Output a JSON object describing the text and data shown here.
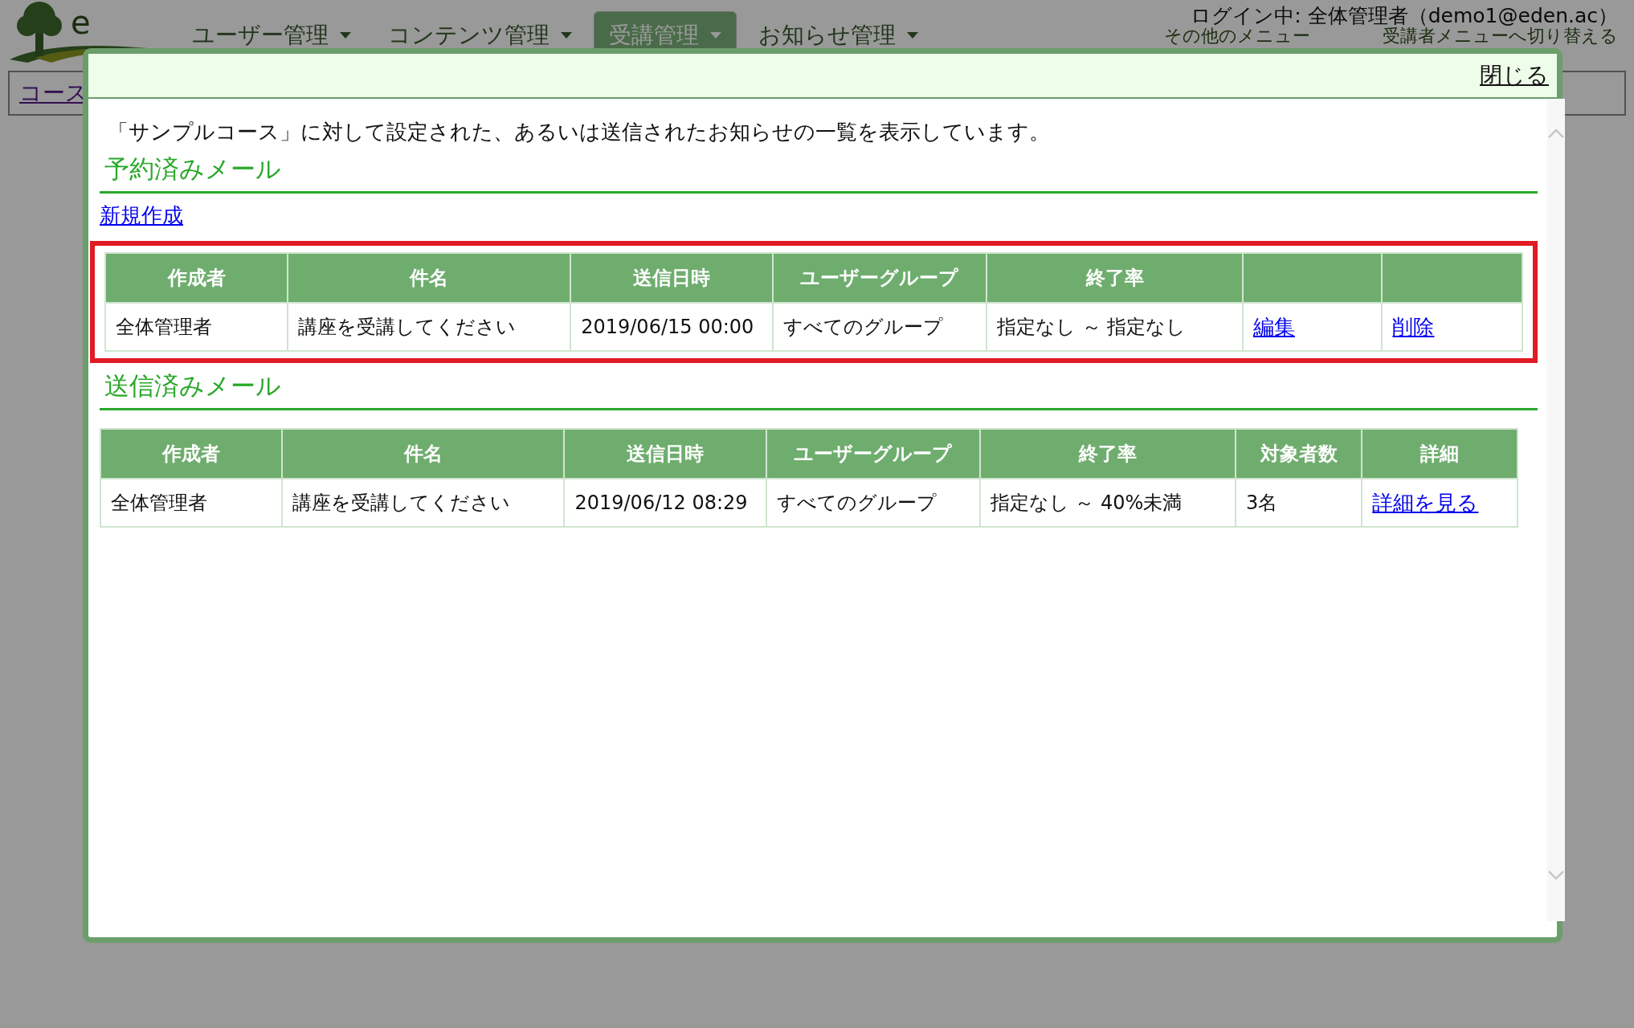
{
  "header": {
    "logo_text": "e",
    "nav": [
      {
        "label": "ユーザー管理",
        "selected": false
      },
      {
        "label": "コンテンツ管理",
        "selected": false
      },
      {
        "label": "受講管理",
        "selected": true
      },
      {
        "label": "お知らせ管理",
        "selected": false
      }
    ],
    "user_info": "ログイン中: 全体管理者（demo1@eden.ac）",
    "sub_links": [
      "その他のメニュー",
      "受講者メニューへ切り替える"
    ]
  },
  "breadcrumb": "コース",
  "dialog": {
    "close": "閉じる",
    "intro": "「サンプルコース」に対して設定された、あるいは送信されたお知らせの一覧を表示しています。",
    "sections": [
      {
        "title": "予約済みメール",
        "new_link": "新規作成",
        "highlighted": true,
        "columns": [
          "作成者",
          "件名",
          "送信日時",
          "ユーザーグループ",
          "終了率",
          "",
          ""
        ],
        "rows": [
          {
            "cells": [
              {
                "kind": "text",
                "text": "全体管理者"
              },
              {
                "kind": "text",
                "text": "講座を受講してください"
              },
              {
                "kind": "text",
                "text": "2019/06/15 00:00"
              },
              {
                "kind": "text",
                "text": "すべてのグループ"
              },
              {
                "kind": "text",
                "text": "指定なし ～ 指定なし"
              },
              {
                "kind": "link",
                "text": "編集"
              },
              {
                "kind": "link",
                "text": "削除"
              }
            ]
          }
        ]
      },
      {
        "title": "送信済みメール",
        "highlighted": false,
        "columns": [
          "作成者",
          "件名",
          "送信日時",
          "ユーザーグループ",
          "終了率",
          "対象者数",
          "詳細"
        ],
        "rows": [
          {
            "cells": [
              {
                "kind": "text",
                "text": "全体管理者"
              },
              {
                "kind": "text",
                "text": "講座を受講してください"
              },
              {
                "kind": "text",
                "text": "2019/06/12 08:29"
              },
              {
                "kind": "text",
                "text": "すべてのグループ"
              },
              {
                "kind": "text",
                "text": "指定なし ～ 40%未満"
              },
              {
                "kind": "text",
                "text": "3名"
              },
              {
                "kind": "link",
                "text": "詳細を見る"
              }
            ]
          }
        ]
      }
    ]
  }
}
